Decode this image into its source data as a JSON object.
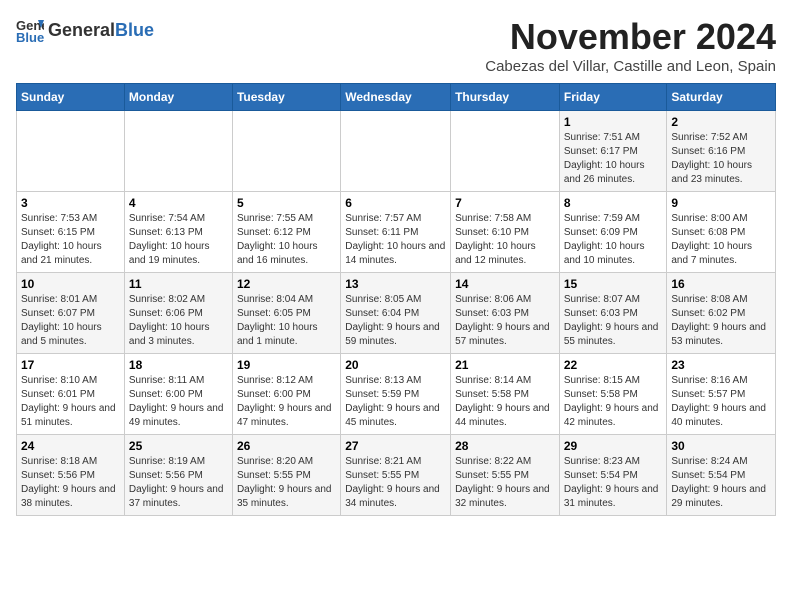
{
  "header": {
    "logo_general": "General",
    "logo_blue": "Blue",
    "title": "November 2024",
    "subtitle": "Cabezas del Villar, Castille and Leon, Spain"
  },
  "columns": [
    "Sunday",
    "Monday",
    "Tuesday",
    "Wednesday",
    "Thursday",
    "Friday",
    "Saturday"
  ],
  "weeks": [
    [
      {
        "day": "",
        "info": ""
      },
      {
        "day": "",
        "info": ""
      },
      {
        "day": "",
        "info": ""
      },
      {
        "day": "",
        "info": ""
      },
      {
        "day": "",
        "info": ""
      },
      {
        "day": "1",
        "info": "Sunrise: 7:51 AM\nSunset: 6:17 PM\nDaylight: 10 hours and 26 minutes."
      },
      {
        "day": "2",
        "info": "Sunrise: 7:52 AM\nSunset: 6:16 PM\nDaylight: 10 hours and 23 minutes."
      }
    ],
    [
      {
        "day": "3",
        "info": "Sunrise: 7:53 AM\nSunset: 6:15 PM\nDaylight: 10 hours and 21 minutes."
      },
      {
        "day": "4",
        "info": "Sunrise: 7:54 AM\nSunset: 6:13 PM\nDaylight: 10 hours and 19 minutes."
      },
      {
        "day": "5",
        "info": "Sunrise: 7:55 AM\nSunset: 6:12 PM\nDaylight: 10 hours and 16 minutes."
      },
      {
        "day": "6",
        "info": "Sunrise: 7:57 AM\nSunset: 6:11 PM\nDaylight: 10 hours and 14 minutes."
      },
      {
        "day": "7",
        "info": "Sunrise: 7:58 AM\nSunset: 6:10 PM\nDaylight: 10 hours and 12 minutes."
      },
      {
        "day": "8",
        "info": "Sunrise: 7:59 AM\nSunset: 6:09 PM\nDaylight: 10 hours and 10 minutes."
      },
      {
        "day": "9",
        "info": "Sunrise: 8:00 AM\nSunset: 6:08 PM\nDaylight: 10 hours and 7 minutes."
      }
    ],
    [
      {
        "day": "10",
        "info": "Sunrise: 8:01 AM\nSunset: 6:07 PM\nDaylight: 10 hours and 5 minutes."
      },
      {
        "day": "11",
        "info": "Sunrise: 8:02 AM\nSunset: 6:06 PM\nDaylight: 10 hours and 3 minutes."
      },
      {
        "day": "12",
        "info": "Sunrise: 8:04 AM\nSunset: 6:05 PM\nDaylight: 10 hours and 1 minute."
      },
      {
        "day": "13",
        "info": "Sunrise: 8:05 AM\nSunset: 6:04 PM\nDaylight: 9 hours and 59 minutes."
      },
      {
        "day": "14",
        "info": "Sunrise: 8:06 AM\nSunset: 6:03 PM\nDaylight: 9 hours and 57 minutes."
      },
      {
        "day": "15",
        "info": "Sunrise: 8:07 AM\nSunset: 6:03 PM\nDaylight: 9 hours and 55 minutes."
      },
      {
        "day": "16",
        "info": "Sunrise: 8:08 AM\nSunset: 6:02 PM\nDaylight: 9 hours and 53 minutes."
      }
    ],
    [
      {
        "day": "17",
        "info": "Sunrise: 8:10 AM\nSunset: 6:01 PM\nDaylight: 9 hours and 51 minutes."
      },
      {
        "day": "18",
        "info": "Sunrise: 8:11 AM\nSunset: 6:00 PM\nDaylight: 9 hours and 49 minutes."
      },
      {
        "day": "19",
        "info": "Sunrise: 8:12 AM\nSunset: 6:00 PM\nDaylight: 9 hours and 47 minutes."
      },
      {
        "day": "20",
        "info": "Sunrise: 8:13 AM\nSunset: 5:59 PM\nDaylight: 9 hours and 45 minutes."
      },
      {
        "day": "21",
        "info": "Sunrise: 8:14 AM\nSunset: 5:58 PM\nDaylight: 9 hours and 44 minutes."
      },
      {
        "day": "22",
        "info": "Sunrise: 8:15 AM\nSunset: 5:58 PM\nDaylight: 9 hours and 42 minutes."
      },
      {
        "day": "23",
        "info": "Sunrise: 8:16 AM\nSunset: 5:57 PM\nDaylight: 9 hours and 40 minutes."
      }
    ],
    [
      {
        "day": "24",
        "info": "Sunrise: 8:18 AM\nSunset: 5:56 PM\nDaylight: 9 hours and 38 minutes."
      },
      {
        "day": "25",
        "info": "Sunrise: 8:19 AM\nSunset: 5:56 PM\nDaylight: 9 hours and 37 minutes."
      },
      {
        "day": "26",
        "info": "Sunrise: 8:20 AM\nSunset: 5:55 PM\nDaylight: 9 hours and 35 minutes."
      },
      {
        "day": "27",
        "info": "Sunrise: 8:21 AM\nSunset: 5:55 PM\nDaylight: 9 hours and 34 minutes."
      },
      {
        "day": "28",
        "info": "Sunrise: 8:22 AM\nSunset: 5:55 PM\nDaylight: 9 hours and 32 minutes."
      },
      {
        "day": "29",
        "info": "Sunrise: 8:23 AM\nSunset: 5:54 PM\nDaylight: 9 hours and 31 minutes."
      },
      {
        "day": "30",
        "info": "Sunrise: 8:24 AM\nSunset: 5:54 PM\nDaylight: 9 hours and 29 minutes."
      }
    ]
  ]
}
